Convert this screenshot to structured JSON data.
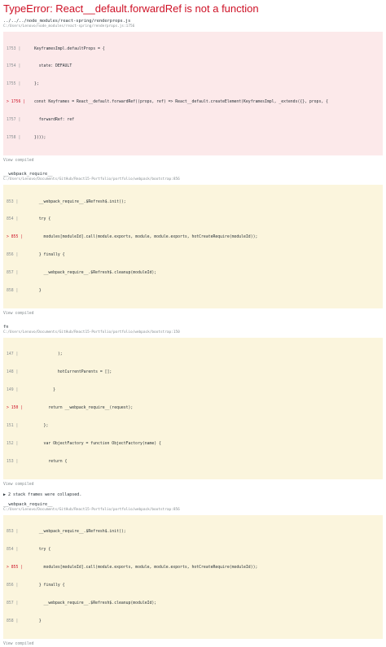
{
  "error_title": "TypeError: React__default.forwardRef is not a function",
  "view_compiled": "View compiled",
  "collapsed_text": "▶ 2 stack frames were collapsed.",
  "frames": [
    {
      "title": "../../../node_modules/react-spring/renderprops.js",
      "path": "C:/Users/Lenovo/node_modules/react-spring/renderprops.js:1756",
      "style": "error",
      "lines": [
        {
          "num": "1753 |",
          "text": "KeyframesImpl.defaultProps = {",
          "hl": false
        },
        {
          "num": "1754 |",
          "text": "  state: DEFAULT",
          "hl": false
        },
        {
          "num": "1755 |",
          "text": "};",
          "hl": false
        },
        {
          "num": "> 1756 |",
          "text": "const Keyframes = React__default.forwardRef((props, ref) => React__default.createElement(KeyframesImpl, _extends({}, props, {",
          "hl": true
        },
        {
          "num": "1757 |",
          "text": "  forwardRef: ref",
          "hl": false
        },
        {
          "num": "1758 |",
          "text": "})));",
          "hl": false
        }
      ]
    },
    {
      "title": "__webpack_require__",
      "path": "C:/Users/Lenovo/Documents/GitHub/React15-Portfolio/portfolio/webpack/bootstrap:856",
      "style": "normal",
      "lines": [
        {
          "num": "853 |",
          "text": "  __webpack_require__.$Refresh$.init();",
          "hl": false
        },
        {
          "num": "854 |",
          "text": "  try {",
          "hl": false
        },
        {
          "num": "> 855 |",
          "text": "    modules[moduleId].call(module.exports, module, module.exports, hotCreateRequire(moduleId));",
          "hl": true
        },
        {
          "num": "856 |",
          "text": "  } finally {",
          "hl": false
        },
        {
          "num": "857 |",
          "text": "    __webpack_require__.$Refresh$.cleanup(moduleId);",
          "hl": false
        },
        {
          "num": "858 |",
          "text": "  }",
          "hl": false
        }
      ]
    },
    {
      "title": "fn",
      "path": "C:/Users/Lenovo/Documents/GitHub/React15-Portfolio/portfolio/webpack/bootstrap:150",
      "style": "normal",
      "lines": [
        {
          "num": "147 |",
          "text": "          );",
          "hl": false
        },
        {
          "num": "148 |",
          "text": "          hotCurrentParents = [];",
          "hl": false
        },
        {
          "num": "149 |",
          "text": "        }",
          "hl": false
        },
        {
          "num": "> 150 |",
          "text": "      return __webpack_require__(request);",
          "hl": true
        },
        {
          "num": "151 |",
          "text": "    };",
          "hl": false
        },
        {
          "num": "152 |",
          "text": "    var ObjectFactory = function ObjectFactory(name) {",
          "hl": false
        },
        {
          "num": "153 |",
          "text": "      return {",
          "hl": false
        }
      ]
    },
    {
      "title": "__webpack_require__",
      "path": "C:/Users/Lenovo/Documents/GitHub/React15-Portfolio/portfolio/webpack/bootstrap:856",
      "style": "normal",
      "lines": [
        {
          "num": "853 |",
          "text": "  __webpack_require__.$Refresh$.init();",
          "hl": false
        },
        {
          "num": "854 |",
          "text": "  try {",
          "hl": false
        },
        {
          "num": "> 855 |",
          "text": "    modules[moduleId].call(module.exports, module, module.exports, hotCreateRequire(moduleId));",
          "hl": true
        },
        {
          "num": "856 |",
          "text": "  } finally {",
          "hl": false
        },
        {
          "num": "857 |",
          "text": "    __webpack_require__.$Refresh$.cleanup(moduleId);",
          "hl": false
        },
        {
          "num": "858 |",
          "text": "  }",
          "hl": false
        }
      ]
    }
  ]
}
